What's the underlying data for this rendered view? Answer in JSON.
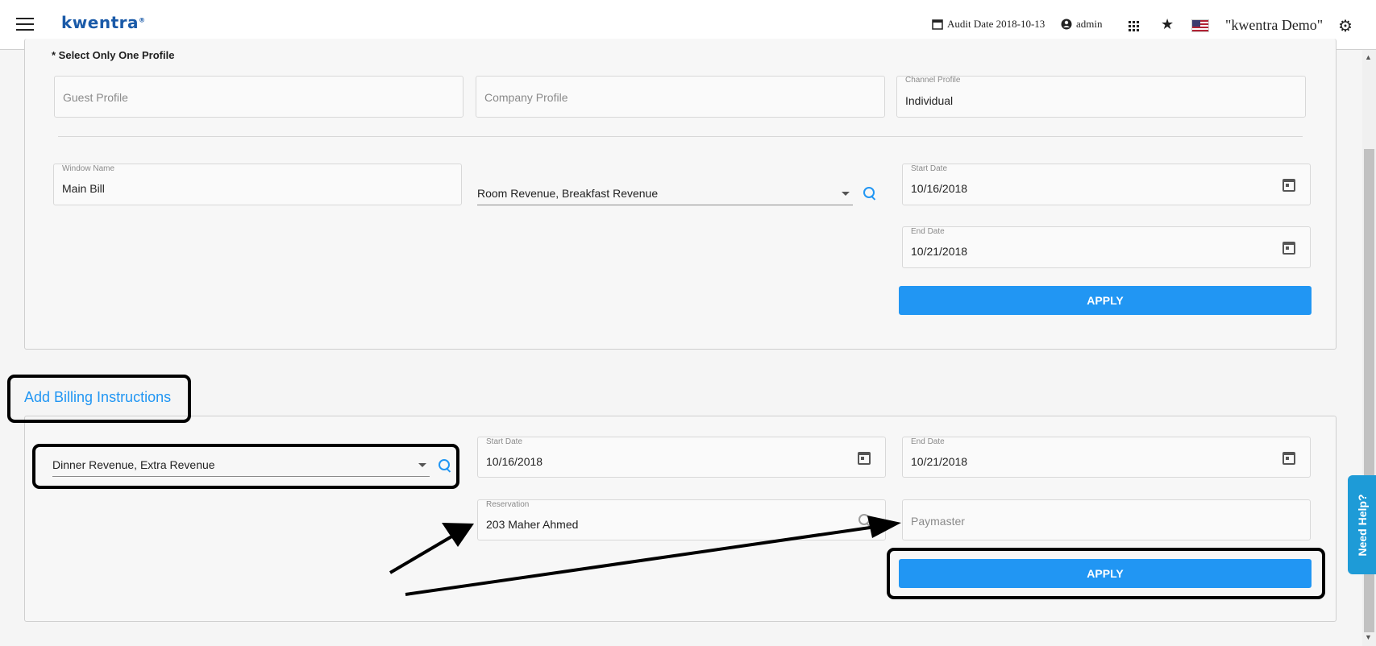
{
  "header": {
    "logo": "kwentra",
    "audit_date": "Audit Date 2018-10-13",
    "user": "admin",
    "hotel": "\"kwentra Demo\""
  },
  "profile_section": {
    "instruction": "* Select Only One Profile",
    "guest_profile_placeholder": "Guest Profile",
    "company_profile_placeholder": "Company Profile",
    "channel_profile_label": "Channel Profile",
    "channel_profile_value": "Individual",
    "window_name_label": "Window Name",
    "window_name_value": "Main Bill",
    "revenue_select_value": "Room Revenue, Breakfast Revenue",
    "start_date_label": "Start Date",
    "start_date_value": "10/16/2018",
    "end_date_label": "End Date",
    "end_date_value": "10/21/2018",
    "apply_label": "APPLY"
  },
  "billing_section": {
    "title": "Add Billing Instructions",
    "revenue_select_value": "Dinner Revenue, Extra Revenue",
    "start_date_label": "Start Date",
    "start_date_value": "10/16/2018",
    "end_date_label": "End Date",
    "end_date_value": "10/21/2018",
    "reservation_label": "Reservation",
    "reservation_value": "203 Maher Ahmed",
    "paymaster_placeholder": "Paymaster",
    "apply_label": "APPLY"
  },
  "need_help": "Need Help?",
  "icons": [
    "menu-icon",
    "calendar-icon",
    "account-circle-icon",
    "apps-grid-icon",
    "star-icon",
    "us-flag-icon",
    "gear-icon",
    "search-icon",
    "dropdown-caret-icon"
  ],
  "colors": {
    "accent": "#2196f3",
    "need_help": "#1e9bd7",
    "logo": "#1a5aa8"
  }
}
